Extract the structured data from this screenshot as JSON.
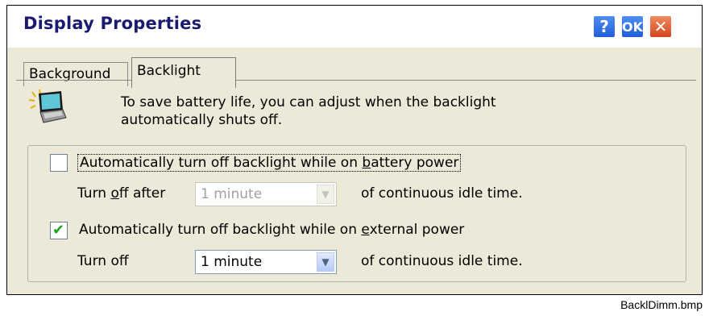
{
  "window": {
    "title": "Display Properties",
    "help_label": "?",
    "ok_label": "OK",
    "close_label": "✕"
  },
  "tabs": [
    {
      "label": "Background",
      "active": false
    },
    {
      "label": "Backlight",
      "active": true
    }
  ],
  "description": {
    "line1": "To save battery life, you can adjust when the backlight",
    "line2": "automatically shuts off."
  },
  "battery": {
    "checked": false,
    "label_pre": "Automatically turn off backlight while on ",
    "label_underlined": "b",
    "label_post": "attery power",
    "turn_off_pre": "Turn ",
    "turn_off_underlined": "o",
    "turn_off_post": "ff after",
    "combo_value": "1 minute",
    "combo_disabled": true,
    "suffix": "of continuous idle time."
  },
  "external": {
    "checked": true,
    "label_pre": "Automatically turn off backlight while on ",
    "label_underlined": "e",
    "label_post": "xternal power",
    "turn_off": "Turn off",
    "combo_value": "1 minute",
    "combo_disabled": false,
    "suffix": "of continuous idle time."
  },
  "caption": "BacklDimm.bmp",
  "icons": {
    "help": "question-icon",
    "ok": "ok-icon",
    "close": "close-icon",
    "laptop": "laptop-backlight-icon",
    "check": "checkmark-icon",
    "dropdown": "chevron-down-icon"
  }
}
